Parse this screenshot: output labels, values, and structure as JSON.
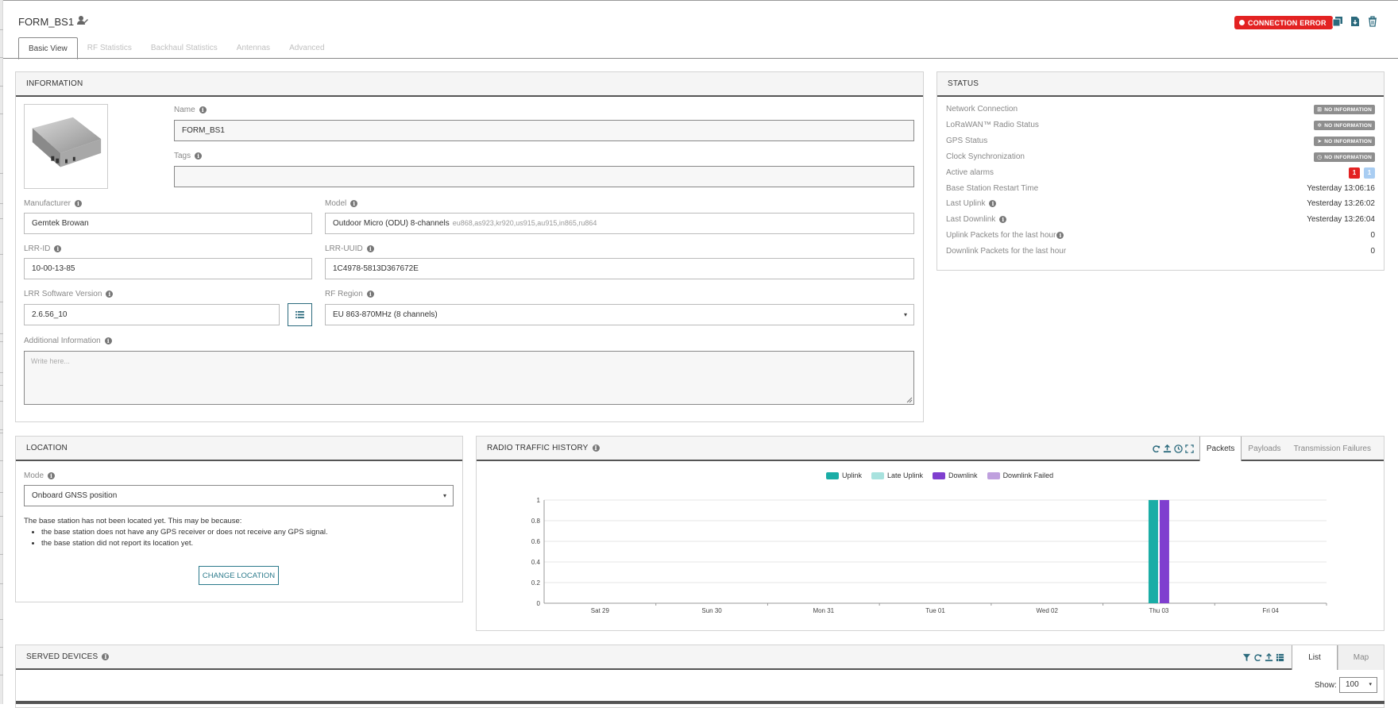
{
  "header": {
    "title": "FORM_BS1",
    "connection_status": "CONNECTION ERROR"
  },
  "tabs": [
    {
      "label": "Basic View",
      "active": true
    },
    {
      "label": "RF Statistics"
    },
    {
      "label": "Backhaul Statistics"
    },
    {
      "label": "Antennas"
    },
    {
      "label": "Advanced"
    }
  ],
  "information": {
    "title": "INFORMATION",
    "name_label": "Name",
    "name_value": "FORM_BS1",
    "tags_label": "Tags",
    "tags_value": "",
    "manufacturer_label": "Manufacturer",
    "manufacturer_value": "Gemtek Browan",
    "model_label": "Model",
    "model_value": "Outdoor Micro (ODU) 8-channels",
    "model_sub": "eu868,as923,kr920,us915,au915,in865,ru864",
    "lrr_id_label": "LRR-ID",
    "lrr_id_value": "10-00-13-85",
    "lrr_uuid_label": "LRR-UUID",
    "lrr_uuid_value": "1C4978-5813D367672E",
    "software_label": "LRR Software Version",
    "software_value": "2.6.56_10",
    "rf_region_label": "RF Region",
    "rf_region_value": "EU 863-870MHz (8 channels)",
    "additional_label": "Additional Information",
    "additional_placeholder": "Write here..."
  },
  "status": {
    "title": "STATUS",
    "no_information": "NO INFORMATION",
    "rows": [
      {
        "label": "Network Connection"
      },
      {
        "label": "LoRaWAN™ Radio Status"
      },
      {
        "label": "GPS Status"
      },
      {
        "label": "Clock Synchronization"
      },
      {
        "label": "Active alarms"
      },
      {
        "label": "Base Station Restart Time",
        "value": "Yesterday 13:06:16"
      },
      {
        "label": "Last Uplink",
        "value": "Yesterday 13:26:02"
      },
      {
        "label": "Last Downlink",
        "value": "Yesterday 13:26:04"
      },
      {
        "label": "Uplink Packets for the last hour",
        "value": "0"
      },
      {
        "label": "Downlink Packets for the last hour",
        "value": "0"
      }
    ],
    "alarms": {
      "critical": "1",
      "info": "1"
    },
    "colors": {
      "critical": "#e32222",
      "info": "#a9cdf2"
    }
  },
  "location": {
    "title": "LOCATION",
    "mode_label": "Mode",
    "mode_value": "Onboard GNSS position",
    "message": "The base station has not been located yet. This may be because:",
    "reasons": [
      "the base station does not have any GPS receiver or does not receive any GPS signal.",
      "the base station did not report its location yet."
    ],
    "change_button": "CHANGE LOCATION"
  },
  "radio_traffic": {
    "title": "RADIO TRAFFIC HISTORY",
    "tabs": [
      "Packets",
      "Payloads",
      "Transmission Failures"
    ],
    "active_tab": "Packets"
  },
  "chart_data": {
    "type": "bar",
    "categories": [
      "Sat 29",
      "Sun 30",
      "Mon 31",
      "Tue 01",
      "Wed 02",
      "Thu 03",
      "Fri 04"
    ],
    "series": [
      {
        "name": "Uplink",
        "color": "#1aada6",
        "values": [
          0,
          0,
          0,
          0,
          0,
          1,
          0
        ]
      },
      {
        "name": "Late Uplink",
        "color": "#a8e2de",
        "values": [
          0,
          0,
          0,
          0,
          0,
          0,
          0
        ]
      },
      {
        "name": "Downlink",
        "color": "#7f3fcf",
        "values": [
          0,
          0,
          0,
          0,
          0,
          1,
          0
        ]
      },
      {
        "name": "Downlink Failed",
        "color": "#bfa0de",
        "values": [
          0,
          0,
          0,
          0,
          0,
          0,
          0
        ]
      }
    ],
    "yticks": [
      "0",
      "0.2",
      "0.4",
      "0.6",
      "0.8",
      "1"
    ],
    "ylim": [
      0,
      1
    ],
    "legend": "top-center",
    "grid": true
  },
  "served_devices": {
    "title": "SERVED DEVICES",
    "tabs": [
      "List",
      "Map"
    ],
    "active_tab": "List",
    "show_label": "Show:",
    "show_value": "100"
  }
}
